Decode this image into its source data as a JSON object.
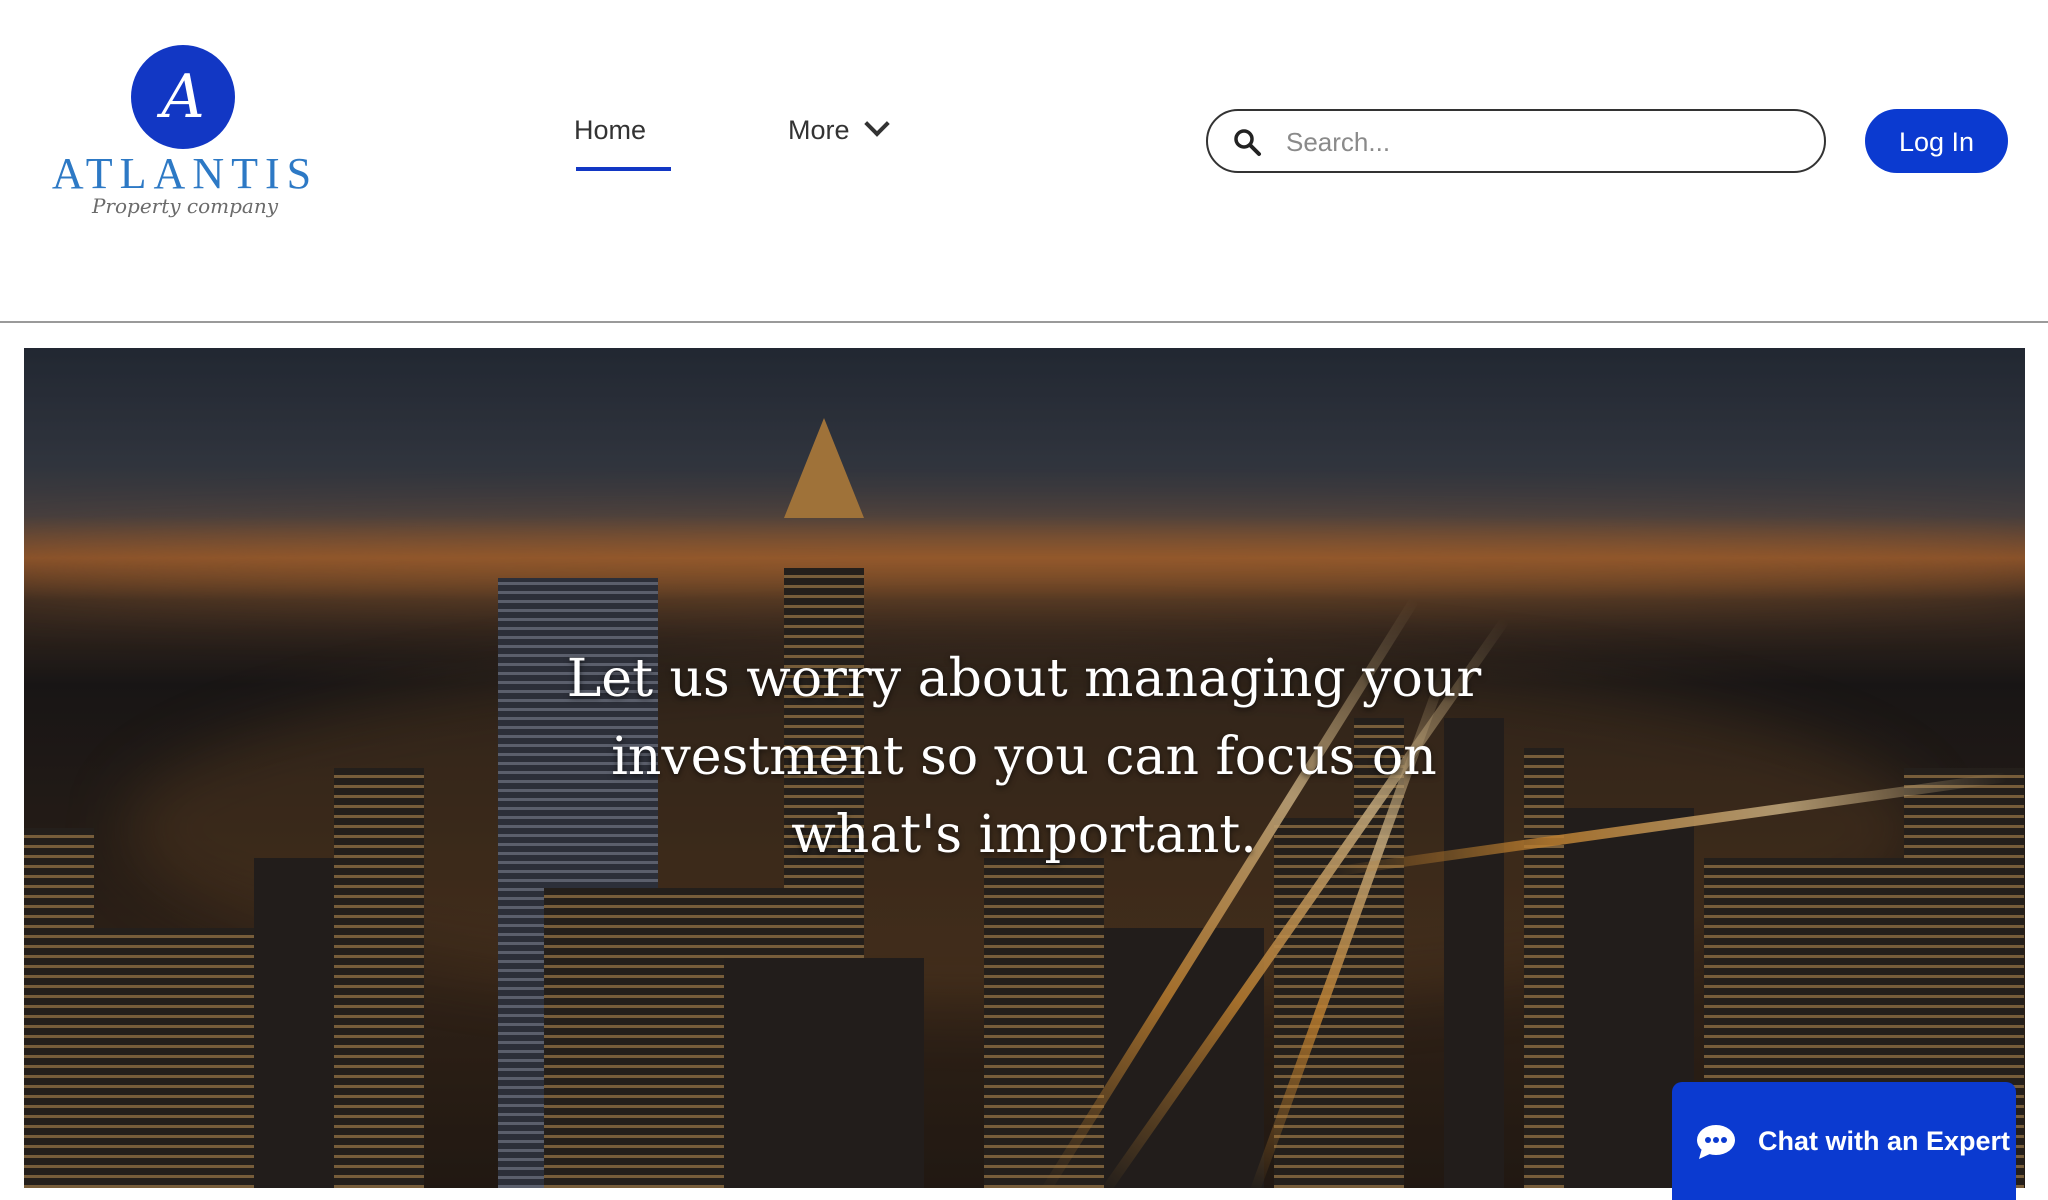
{
  "brand": {
    "monogram": "A",
    "name": "ATLANTIS",
    "tagline": "Property company",
    "color": "#1237c4"
  },
  "nav": {
    "items": [
      {
        "label": "Home",
        "active": true
      },
      {
        "label": "More",
        "has_dropdown": true
      }
    ]
  },
  "search": {
    "placeholder": "Search...",
    "value": ""
  },
  "header_actions": {
    "login_label": "Log In",
    "login_color": "#0b3ad0"
  },
  "hero": {
    "headline_line1": "Let us worry about managing your",
    "headline_line2": "investment so you can focus on",
    "headline_line3": "what's important.",
    "image": "city-skyline-at-night"
  },
  "chat_widget": {
    "label": "Chat with an Expert",
    "icon": "chat-bubble-icon",
    "color": "#0b3ad0"
  }
}
